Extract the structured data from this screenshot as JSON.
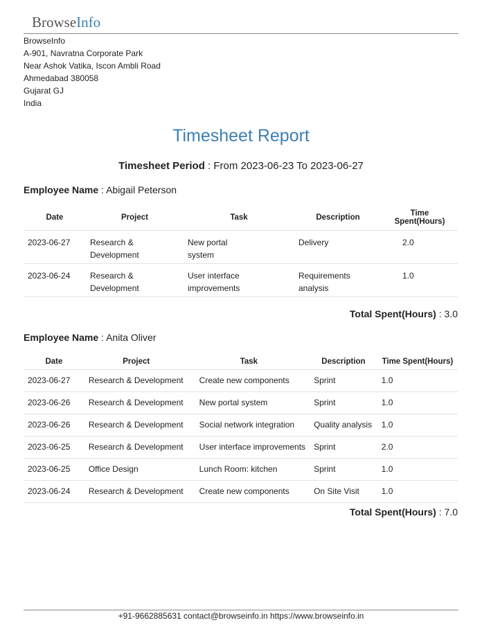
{
  "header": {
    "logo_part1": "Browse",
    "logo_part2": "Info"
  },
  "company": {
    "lines": [
      "BrowseInfo",
      "A-901, Navratna Corporate Park",
      "Near Ashok Vatika, Iscon Ambli Road",
      "Ahmedabad 380058",
      "Gujarat GJ",
      "India"
    ]
  },
  "report": {
    "title": "Timesheet Report",
    "period_label": "Timesheet Period",
    "period_value": " : From 2023-06-23 To 2023-06-27"
  },
  "employee_label": "Employee Name",
  "total_label": "Total Spent(Hours)",
  "employees": [
    {
      "name": " : Abigail Peterson",
      "columns": [
        "Date",
        "Project",
        "Task",
        "Description",
        "Time Spent(Hours)"
      ],
      "rows": [
        [
          "2023-06-27",
          "Research & Development",
          "New portal system",
          "Delivery",
          "2.0"
        ],
        [
          "2023-06-24",
          "Research & Development",
          "User interface improvements",
          "Requirements analysis",
          "1.0"
        ]
      ],
      "total": " : 3.0"
    },
    {
      "name": " : Anita Oliver",
      "columns": [
        "Date",
        "Project",
        "Task",
        "Description",
        "Time Spent(Hours)"
      ],
      "rows": [
        [
          "2023-06-27",
          "Research & Development",
          "Create new components",
          "Sprint",
          "1.0"
        ],
        [
          "2023-06-26",
          "Research & Development",
          "New portal system",
          "Sprint",
          "1.0"
        ],
        [
          "2023-06-26",
          "Research & Development",
          "Social network integration",
          "Quality analysis",
          "1.0"
        ],
        [
          "2023-06-25",
          "Research & Development",
          "User interface improvements",
          "Sprint",
          "2.0"
        ],
        [
          "2023-06-25",
          "Office Design",
          "Lunch Room: kitchen",
          "Sprint",
          "1.0"
        ],
        [
          "2023-06-24",
          "Research & Development",
          "Create new components",
          "On Site Visit",
          "1.0"
        ]
      ],
      "total": " : 7.0"
    }
  ],
  "footer": {
    "text": "+91-9662885631 contact@browseinfo.in https://www.browseinfo.in"
  }
}
